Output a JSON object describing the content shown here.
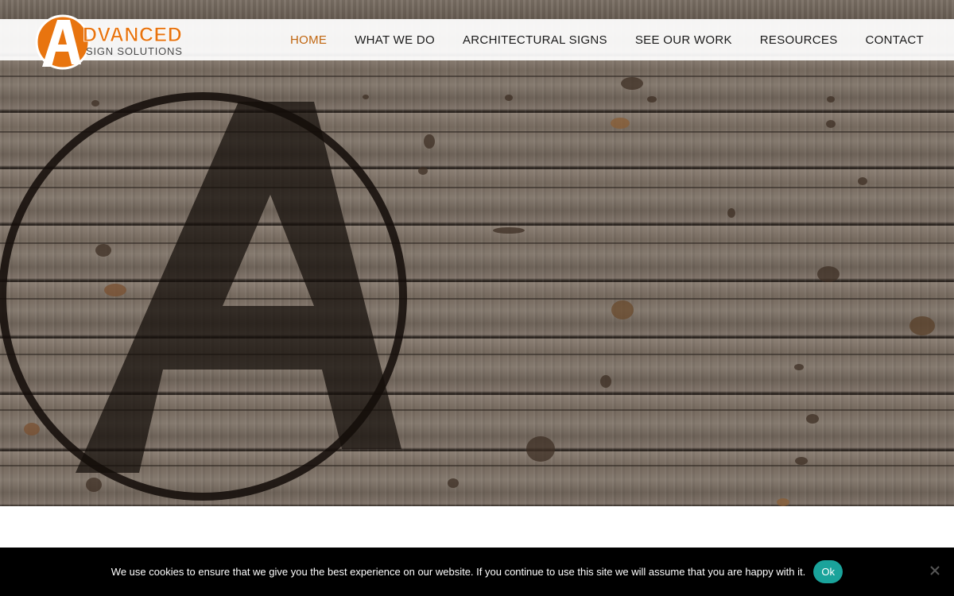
{
  "brand": {
    "logo_word": "DVANCED",
    "logo_tagline": "SIGN SOLUTIONS",
    "accent_color": "#e8740f"
  },
  "nav": {
    "items": [
      {
        "label": "HOME",
        "active": true
      },
      {
        "label": "WHAT WE DO",
        "active": false
      },
      {
        "label": "ARCHITECTURAL SIGNS",
        "active": false
      },
      {
        "label": "SEE OUR WORK",
        "active": false
      },
      {
        "label": "RESOURCES",
        "active": false
      },
      {
        "label": "CONTACT",
        "active": false
      }
    ],
    "active_color": "#c0650f"
  },
  "hero": {
    "background": "weathered wood planks",
    "emblem_icon": "burned-a-logo-icon"
  },
  "cookie": {
    "message": "We use cookies to ensure that we give you the best experience on our website. If you continue to use this site we will assume that you are happy with it.",
    "ok_label": "Ok",
    "ok_color": "#1aa39b",
    "close_icon": "close-icon"
  }
}
